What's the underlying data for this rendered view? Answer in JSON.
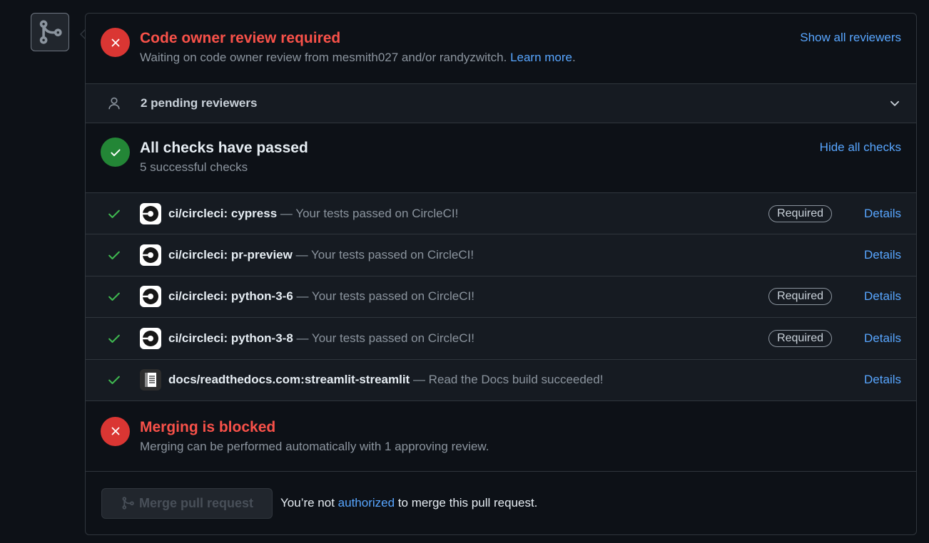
{
  "colors": {
    "background": "#0d1117",
    "error": "#f85149",
    "success": "#238636",
    "link": "#58a6ff"
  },
  "merge_icon": "git-merge-icon",
  "code_owner": {
    "title": "Code owner review required",
    "subtitle": "Waiting on code owner review from mesmith027 and/or randyzwitch.",
    "learn_more": "Learn more",
    "period": ".",
    "show_reviewers": "Show all reviewers"
  },
  "pending": {
    "label": "2 pending reviewers"
  },
  "checks": {
    "title": "All checks have passed",
    "subtitle": "5 successful checks",
    "hide_link": "Hide all checks",
    "items": [
      {
        "name": "ci/circleci: cypress",
        "message": "— Your tests passed on CircleCI!",
        "required": "Required",
        "details": "Details",
        "icon": "circleci-icon"
      },
      {
        "name": "ci/circleci: pr-preview",
        "message": "— Your tests passed on CircleCI!",
        "required": "",
        "details": "Details",
        "icon": "circleci-icon"
      },
      {
        "name": "ci/circleci: python-3-6",
        "message": "— Your tests passed on CircleCI!",
        "required": "Required",
        "details": "Details",
        "icon": "circleci-icon"
      },
      {
        "name": "ci/circleci: python-3-8",
        "message": "— Your tests passed on CircleCI!",
        "required": "Required",
        "details": "Details",
        "icon": "circleci-icon"
      },
      {
        "name": "docs/readthedocs.com:streamlit-streamlit",
        "message": "— Read the Docs build succeeded!",
        "required": "",
        "details": "Details",
        "icon": "readthedocs-icon"
      }
    ]
  },
  "blocked": {
    "title": "Merging is blocked",
    "subtitle": "Merging can be performed automatically with 1 approving review."
  },
  "merge": {
    "button": "Merge pull request",
    "note_before": "You’re not",
    "note_link": "authorized",
    "note_after": "to merge this pull request."
  }
}
